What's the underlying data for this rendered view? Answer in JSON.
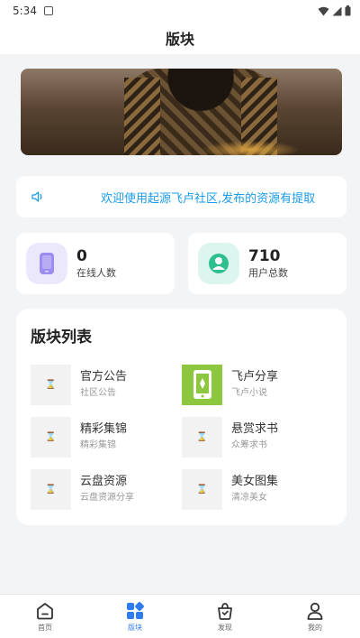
{
  "status_bar": {
    "time": "5:34"
  },
  "header": {
    "title": "版块"
  },
  "notice": {
    "text": "欢迎使用起源飞卢社区,发布的资源有提取"
  },
  "stats": {
    "online": {
      "value": "0",
      "label": "在线人数"
    },
    "users": {
      "value": "710",
      "label": "用户总数"
    }
  },
  "boards": {
    "title": "版块列表",
    "items": [
      {
        "name": "官方公告",
        "desc": "社区公告",
        "thumb": "hourglass-icon"
      },
      {
        "name": "飞卢分享",
        "desc": "飞卢小说",
        "thumb": "phone-icon"
      },
      {
        "name": "精彩集锦",
        "desc": "精彩集锦",
        "thumb": "hourglass-icon"
      },
      {
        "name": "悬赏求书",
        "desc": "众筹求书",
        "thumb": "hourglass-icon"
      },
      {
        "name": "云盘资源",
        "desc": "云盘资源分享",
        "thumb": "hourglass-icon"
      },
      {
        "name": "美女图集",
        "desc": "清凉美女",
        "thumb": "hourglass-icon"
      }
    ]
  },
  "tabbar": {
    "items": [
      {
        "label": "首页",
        "icon": "home-icon",
        "active": false
      },
      {
        "label": "版块",
        "icon": "grid-icon",
        "active": true
      },
      {
        "label": "发现",
        "icon": "discover-icon",
        "active": false
      },
      {
        "label": "我的",
        "icon": "person-icon",
        "active": false
      }
    ]
  },
  "colors": {
    "accent": "#2f7bf0",
    "notice_text": "#1a9be8",
    "online_icon": "#9b8cf0",
    "users_icon": "#2fbf8f",
    "board_green": "#8dc63f"
  }
}
